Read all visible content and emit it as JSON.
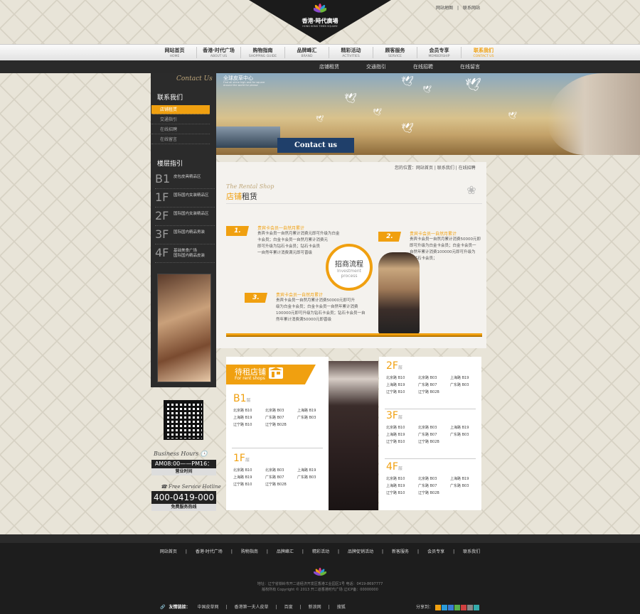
{
  "header": {
    "logo_title": "香港·時代廣場",
    "logo_sub": "HONG KONG TIMES SQUARE",
    "top_links": [
      "网站地图",
      "|",
      "联系网站"
    ]
  },
  "main_nav": [
    {
      "label": "网站首页",
      "sub": "HOME"
    },
    {
      "label": "香港·时代广场",
      "sub": "ABOUT US"
    },
    {
      "label": "购物指南",
      "sub": "SHOPPING GUIDE"
    },
    {
      "label": "品牌峰汇",
      "sub": "BRAND"
    },
    {
      "label": "精彩活动",
      "sub": "ACTIVITIES"
    },
    {
      "label": "顾客服务",
      "sub": "SERVICE"
    },
    {
      "label": "会员专享",
      "sub": "MEMBERSHIP"
    },
    {
      "label": "联系我们",
      "sub": "CONTACT US",
      "active": true
    }
  ],
  "sub_nav": [
    "店铺租赁",
    "交通指引",
    "在线招聘",
    "在线留言"
  ],
  "sidebar": {
    "en_title": "Contact Us",
    "title": "联系我们",
    "items": [
      "店铺租赁",
      "交通指引",
      "在线招聘",
      "在线留言"
    ],
    "active_index": 0,
    "floor_title": "楼层指引",
    "floors": [
      {
        "num": "B1",
        "desc": "皮包皮具精品区"
      },
      {
        "num": "1F",
        "desc": "国际国内女装精品区"
      },
      {
        "num": "2F",
        "desc": "国际国内女装精品区"
      },
      {
        "num": "3F",
        "desc": "国际国内精品男装"
      },
      {
        "num": "4F",
        "desc": "基础美食广场\n国际国内精品皮装"
      }
    ],
    "hours_label": "Business Hours",
    "hours": "AM08:00——PM16：30",
    "hours_caption": "营业时间",
    "hotline_label": "Free Service Hotline",
    "hotline": "400-0419-000",
    "hotline_caption": "免费服务热线"
  },
  "banner": {
    "tag": "全球皮草中心",
    "tag_sub": "Find all shine high and far square\nAround the world for please",
    "button": "Contact us"
  },
  "breadcrumb": "您的位置：网站首页 | 联系我们 | 在线招聘",
  "category": {
    "en": "The Rental Shop",
    "cn_a": "店铺",
    "cn_b": "租赁"
  },
  "process": {
    "circle_cn": "招商流程",
    "circle_en": "Investment process",
    "steps": [
      {
        "num": "1.",
        "title": "贵宾卡会员一自然月累计",
        "desc": "贵宾卡会员一自然月累计消费元即可升级为白金\n卡会员；白金卡会员一自然月累计消费元\n即可升级为钻石卡会员；钻石卡会员\n一自然年累计消费满元即可晋级"
      },
      {
        "num": "2.",
        "title": "贵宾卡会员一自然月累计",
        "desc": "贵宾卡会员一自然月累计消费50000元即\n即可升级为白金卡会员；白金卡会员一\n自然年累计消费100000元即可升级为\n为钻石卡会员；"
      },
      {
        "num": "3.",
        "title": "贵宾卡会员一自然月累计",
        "desc": "贵宾卡会员一自然月累计消费50000元即可升\n级为白金卡会员；白金卡会员一自然年累计消费\n100000元即可升级为钻石卡会员；钻石卡会员一自\n然年累计消费满50000元即晋级"
      }
    ]
  },
  "rent": {
    "title_cn": "待租店铺",
    "title_en": "For rent shops",
    "floor_suffix": "层",
    "floors": [
      {
        "name": "B1",
        "rows": [
          [
            "北京路 B10",
            "北京路 B03",
            "上海路 B19"
          ],
          [
            "上海路 B19",
            "广东路 B07",
            "广东路 B03"
          ],
          [
            "辽宁路 B10",
            "辽宁路 B02B",
            ""
          ]
        ]
      },
      {
        "name": "1F",
        "rows": [
          [
            "北京路 B10",
            "北京路 B03",
            "上海路 B19"
          ],
          [
            "上海路 B19",
            "广东路 B07",
            "广东路 B03"
          ],
          [
            "辽宁路 B10",
            "辽宁路 B02B",
            ""
          ]
        ]
      },
      {
        "name": "2F",
        "rows": [
          [
            "北京路 B10",
            "北京路 B03",
            "上海路 B19"
          ],
          [
            "上海路 B19",
            "广东路 B07",
            "广东路 B03"
          ],
          [
            "辽宁路 B10",
            "辽宁路 B02B",
            ""
          ]
        ]
      },
      {
        "name": "3F",
        "rows": [
          [
            "北京路 B10",
            "北京路 B03",
            "上海路 B19"
          ],
          [
            "上海路 B19",
            "广东路 B07",
            "广东路 B03"
          ],
          [
            "辽宁路 B10",
            "辽宁路 B02B",
            ""
          ]
        ]
      },
      {
        "name": "4F",
        "rows": [
          [
            "北京路 B10",
            "北京路 B03",
            "上海路 B19"
          ],
          [
            "上海路 B19",
            "广东路 B07",
            "广东路 B03"
          ],
          [
            "辽宁路 B10",
            "辽宁路 B02B",
            ""
          ]
        ]
      }
    ]
  },
  "footer": {
    "nav": [
      "网站首页",
      "香港·时代广场",
      "购物指南",
      "品牌峰汇",
      "精彩活动",
      "品牌促销活动",
      "新客服务",
      "会员专享",
      "联系我们"
    ],
    "address": "地址：辽宁省铁岭市开二道经济开发区香港工业园区1号   电话：0419-8697777",
    "copyright": "版权所有  Copyright © 2013 开二道香港时代广场   辽ICP备：00000000",
    "links_label": "友情链接：",
    "links": [
      "中国皮草网",
      "香港第一夫人皮草",
      "百度",
      "新浪网",
      "搜狐"
    ],
    "share_label": "分享到："
  },
  "colors": {
    "accent": "#f0a010",
    "dark": "#2b2b2b",
    "footer": "#1d1d1d"
  }
}
